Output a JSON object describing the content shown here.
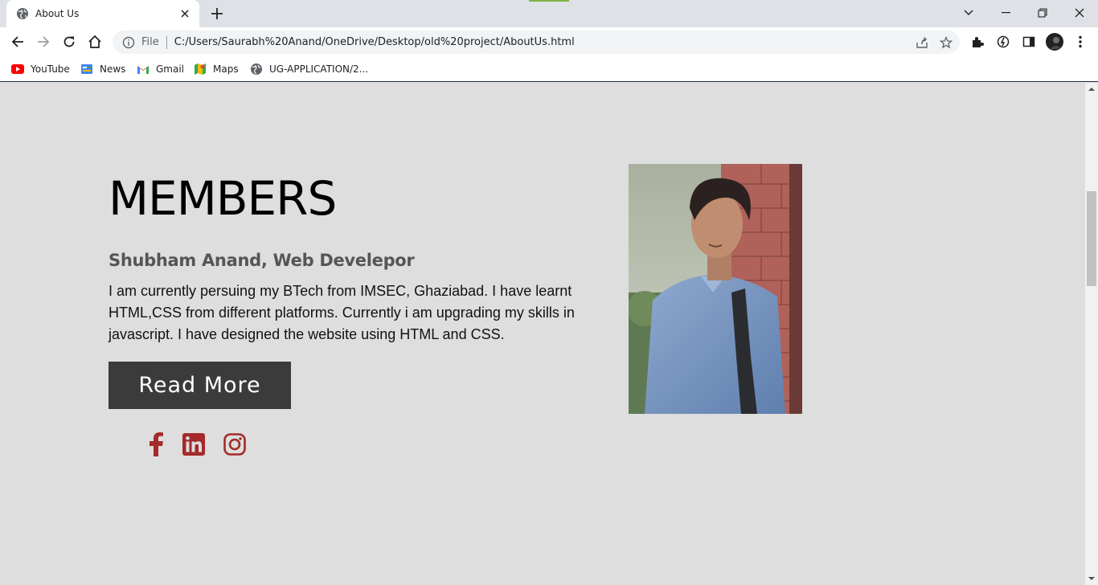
{
  "browser": {
    "tab": {
      "title": "About Us"
    },
    "address": {
      "scheme": "File",
      "url": "C:/Users/Saurabh%20Anand/OneDrive/Desktop/old%20project/AboutUs.html"
    },
    "bookmarks": [
      {
        "label": "YouTube",
        "icon": "youtube-icon"
      },
      {
        "label": "News",
        "icon": "news-icon"
      },
      {
        "label": "Gmail",
        "icon": "gmail-icon"
      },
      {
        "label": "Maps",
        "icon": "maps-icon"
      },
      {
        "label": "UG-APPLICATION/2...",
        "icon": "globe-icon"
      }
    ]
  },
  "member": {
    "heading": "MEMBERS",
    "name_role": "Shubham Anand, Web Develepor",
    "bio": "I am currently persuing my BTech from IMSEC, Ghaziabad. I have learnt HTML,CSS from different platforms. Currently i am upgrading my skills in javascript. I have designed the website using HTML and CSS.",
    "button_label": "Read More",
    "social": [
      "facebook-icon",
      "linkedin-icon",
      "instagram-icon"
    ]
  },
  "colors": {
    "page_bg": "#dedede",
    "button_bg": "#3b3b3b",
    "social_icon": "#a52a2a"
  }
}
